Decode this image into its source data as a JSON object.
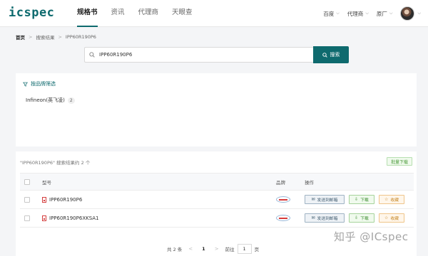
{
  "header": {
    "logo": "icspec",
    "nav": [
      "规格书",
      "资讯",
      "代理商",
      "天眼查"
    ],
    "menus": [
      "百度",
      "代理商",
      "原厂"
    ],
    "chevron": "⌵"
  },
  "breadcrumb": {
    "home": "首页",
    "items": [
      "搜索结果",
      "IPP60R190P6"
    ],
    "sep": ">"
  },
  "search": {
    "value": "IPP60R190P6",
    "button": "搜索"
  },
  "filter": {
    "title": "按品牌筛选",
    "brand": "Infineon(英飞凌)",
    "count": "2"
  },
  "results": {
    "summary": "\"IPP60R190P6\" 搜索结果约 2 个",
    "bulk_download": "批量下载",
    "columns": {
      "model": "型号",
      "brand": "品牌",
      "ops": "操作"
    },
    "rows": [
      {
        "model": "IPP60R190P6"
      },
      {
        "model": "IPP60R190P6XKSA1"
      }
    ],
    "ops": {
      "mail": "发送到邮箱",
      "download": "下载",
      "favorite": "收藏"
    }
  },
  "pager": {
    "total": "共 2 条",
    "prev": "<",
    "page": "1",
    "next": ">",
    "goto": "前往",
    "input": "1",
    "page_unit": "页"
  },
  "watermark": "知乎 @ICspec",
  "colors": {
    "accent": "#0e6a6e"
  }
}
